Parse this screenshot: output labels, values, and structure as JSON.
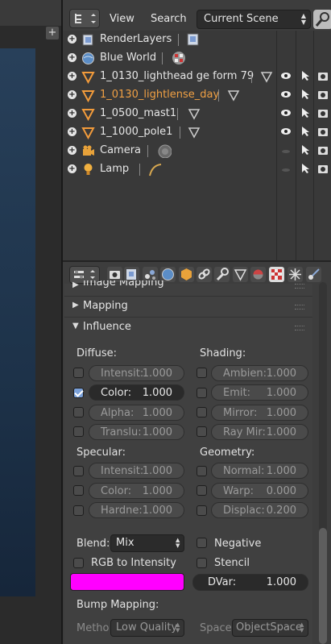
{
  "outliner": {
    "menu_view": "View",
    "menu_search": "Search",
    "scene_select": "Current Scene",
    "items": [
      {
        "label": "RenderLayers",
        "icon": "render-layers-icon",
        "color": "#e6e6e6"
      },
      {
        "label": "Blue World",
        "icon": "world-icon",
        "color": "#e6e6e6"
      },
      {
        "label": "1_0130_lighthead ge form 79",
        "icon": "mesh-triangle-icon",
        "color": "#e6e6e6"
      },
      {
        "label": "1_0130_lightlense_day",
        "icon": "mesh-triangle-icon",
        "color": "#f0a044"
      },
      {
        "label": "1_0500_mast1",
        "icon": "mesh-triangle-icon",
        "color": "#e6e6e6"
      },
      {
        "label": "1_1000_pole1",
        "icon": "mesh-triangle-icon",
        "color": "#e6e6e6"
      },
      {
        "label": "Camera",
        "icon": "camera-icon",
        "color": "#e6e6e6"
      },
      {
        "label": "Lamp",
        "icon": "lamp-icon",
        "color": "#e6e6e6"
      }
    ]
  },
  "properties": {
    "panel_image_mapping": "Image Mapping",
    "panel_mapping": "Mapping",
    "panel_influence": "Influence",
    "diffuse_label": "Diffuse:",
    "shading_label": "Shading:",
    "specular_label": "Specular:",
    "geometry_label": "Geometry:",
    "diffuse": [
      {
        "label": "Intensit:",
        "value": "1.000",
        "checked": false
      },
      {
        "label": "Color:",
        "value": "1.000",
        "checked": true
      },
      {
        "label": "Alpha:",
        "value": "1.000",
        "checked": false
      },
      {
        "label": "Translu:",
        "value": "1.000",
        "checked": false
      }
    ],
    "shading": [
      {
        "label": "Ambien:",
        "value": "1.000"
      },
      {
        "label": "Emit:",
        "value": "1.000"
      },
      {
        "label": "Mirror:",
        "value": "1.000"
      },
      {
        "label": "Ray Mir:",
        "value": "1.000"
      }
    ],
    "specular": [
      {
        "label": "Intensit:",
        "value": "1.000"
      },
      {
        "label": "Color:",
        "value": "1.000"
      },
      {
        "label": "Hardne:",
        "value": "1.000"
      }
    ],
    "geometry": [
      {
        "label": "Normal:",
        "value": "1.000"
      },
      {
        "label": "Warp:",
        "value": "0.000"
      },
      {
        "label": "Displac:",
        "value": "0.200"
      }
    ],
    "blend_label": "Blend:",
    "blend_value": "Mix",
    "negative_label": "Negative",
    "rgb_to_intensity_label": "RGB to Intensity",
    "stencil_label": "Stencil",
    "color_swatch": "#ff00ff",
    "dvar_label": "DVar:",
    "dvar_value": "1.000",
    "bump_mapping_label": "Bump Mapping:",
    "method_label": "Metho",
    "method_value": "Low Quality",
    "space_label": "Space:",
    "space_value": "ObjectSpace"
  }
}
